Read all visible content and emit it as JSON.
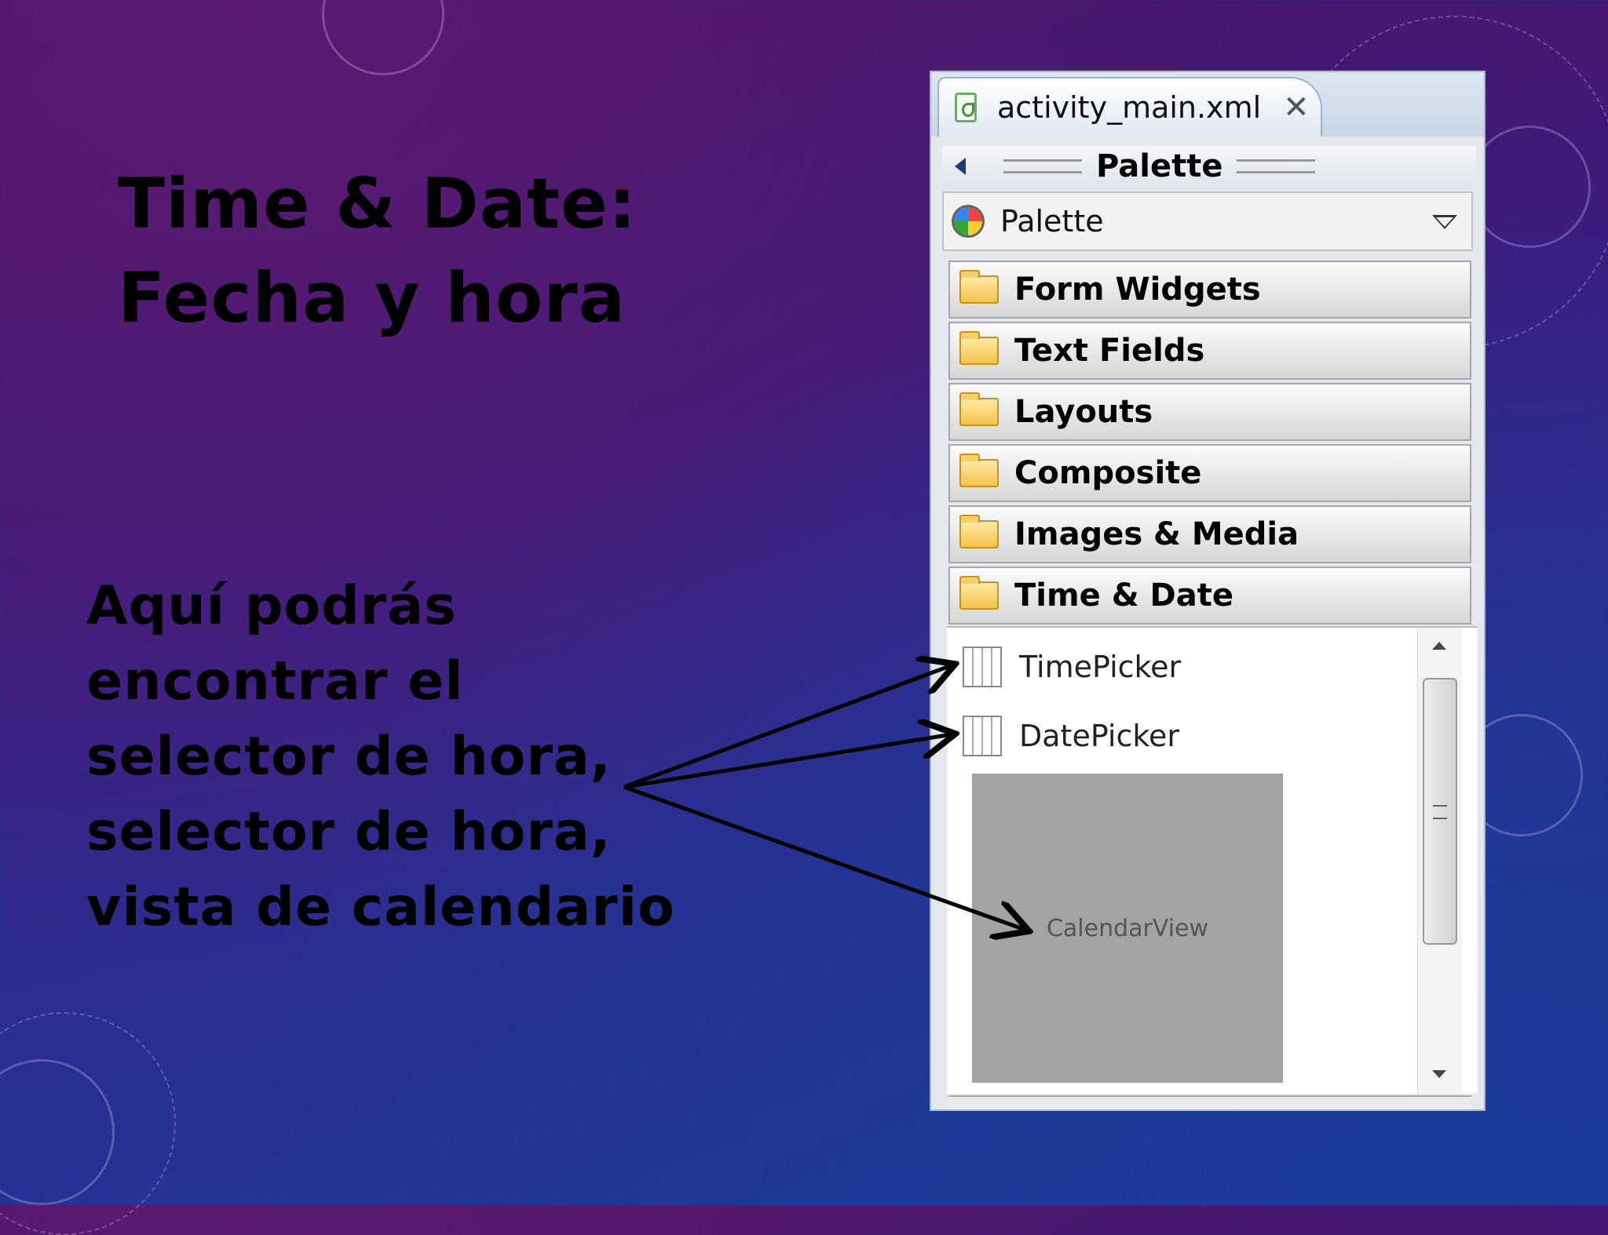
{
  "slide": {
    "title_line1": "Time & Date:",
    "title_line2": "Fecha y hora",
    "body_lines": [
      "Aquí podrás",
      "encontrar el",
      "selector de hora,",
      "selector de hora,",
      "vista de calendario"
    ]
  },
  "editor": {
    "tab_label": "activity_main.xml",
    "tab_close_icon": "✕",
    "palette_header": "Palette",
    "palette_dropdown_label": "Palette",
    "categories": [
      {
        "label": "Form Widgets",
        "icon": "folder-icon",
        "expanded": false
      },
      {
        "label": "Text Fields",
        "icon": "folder-icon",
        "expanded": false
      },
      {
        "label": "Layouts",
        "icon": "folder-icon",
        "expanded": false
      },
      {
        "label": "Composite",
        "icon": "folder-icon",
        "expanded": false
      },
      {
        "label": "Images & Media",
        "icon": "folder-icon",
        "expanded": false
      },
      {
        "label": "Time & Date",
        "icon": "folder-open-icon",
        "expanded": true
      }
    ],
    "items": [
      {
        "label": "TimePicker",
        "icon": "timepicker-icon"
      },
      {
        "label": "DatePicker",
        "icon": "datepicker-icon"
      }
    ],
    "calendar_preview_label": "CalendarView"
  },
  "colors": {
    "background_top": "#4e1467",
    "background_bottom": "#1e3a9a",
    "text": "#000000"
  }
}
